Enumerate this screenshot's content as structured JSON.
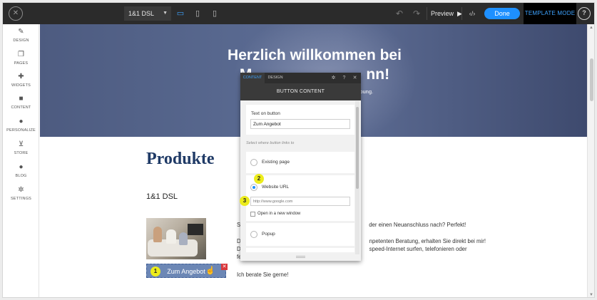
{
  "topbar": {
    "domain_select": "1&1 DSL",
    "preview_label": "Preview",
    "done_label": "Done",
    "template_mode_label": "TEMPLATE MODE",
    "help_label": "?"
  },
  "sidebar": {
    "items": [
      {
        "label": "DESIGN",
        "icon": "brush-icon"
      },
      {
        "label": "PAGES",
        "icon": "pages-icon"
      },
      {
        "label": "WIDGETS",
        "icon": "plus-icon"
      },
      {
        "label": "CONTENT",
        "icon": "folder-icon"
      },
      {
        "label": "PERSONALIZE",
        "icon": "person-icon"
      },
      {
        "label": "STORE",
        "icon": "cart-icon"
      },
      {
        "label": "BLOG",
        "icon": "chat-icon"
      },
      {
        "label": "SETTINGS",
        "icon": "gear-icon"
      }
    ]
  },
  "hero": {
    "title_line1": "Herzlich willkommen bei",
    "title_line2_left": "M",
    "title_line2_mid": "M",
    "title_line2_right": "nn!",
    "subtitle_fragment": "gebung."
  },
  "main": {
    "products_title": "Produkte",
    "product_name": "1&1 DSL",
    "cta_label": "Zum Angebot",
    "text_lines": [
      {
        "prefix": "S",
        "text": "der einen Neuanschluss nach? Perfekt!"
      },
      {
        "prefix": "D",
        "text": "npetenten Beratung, erhalten Sie direkt bei mir!"
      },
      {
        "prefix": "D",
        "text": "speed-Internet surfen, telefonieren oder"
      },
      {
        "prefix": "fe",
        "text": ""
      }
    ],
    "closing": "Ich berate Sie gerne!"
  },
  "panel": {
    "tabs": [
      "CONTENT",
      "DESIGN"
    ],
    "header": "BUTTON CONTENT",
    "text_on_button_label": "Text on button",
    "text_on_button_value": "Zum Angebot",
    "link_section_label": "Select where button links to",
    "options": {
      "existing_page": "Existing page",
      "website_url": "Website URL",
      "url_placeholder": "http://www.google.com",
      "open_new_window": "Open in a new window",
      "popup": "Popup"
    }
  },
  "markers": [
    "1",
    "2",
    "3"
  ]
}
